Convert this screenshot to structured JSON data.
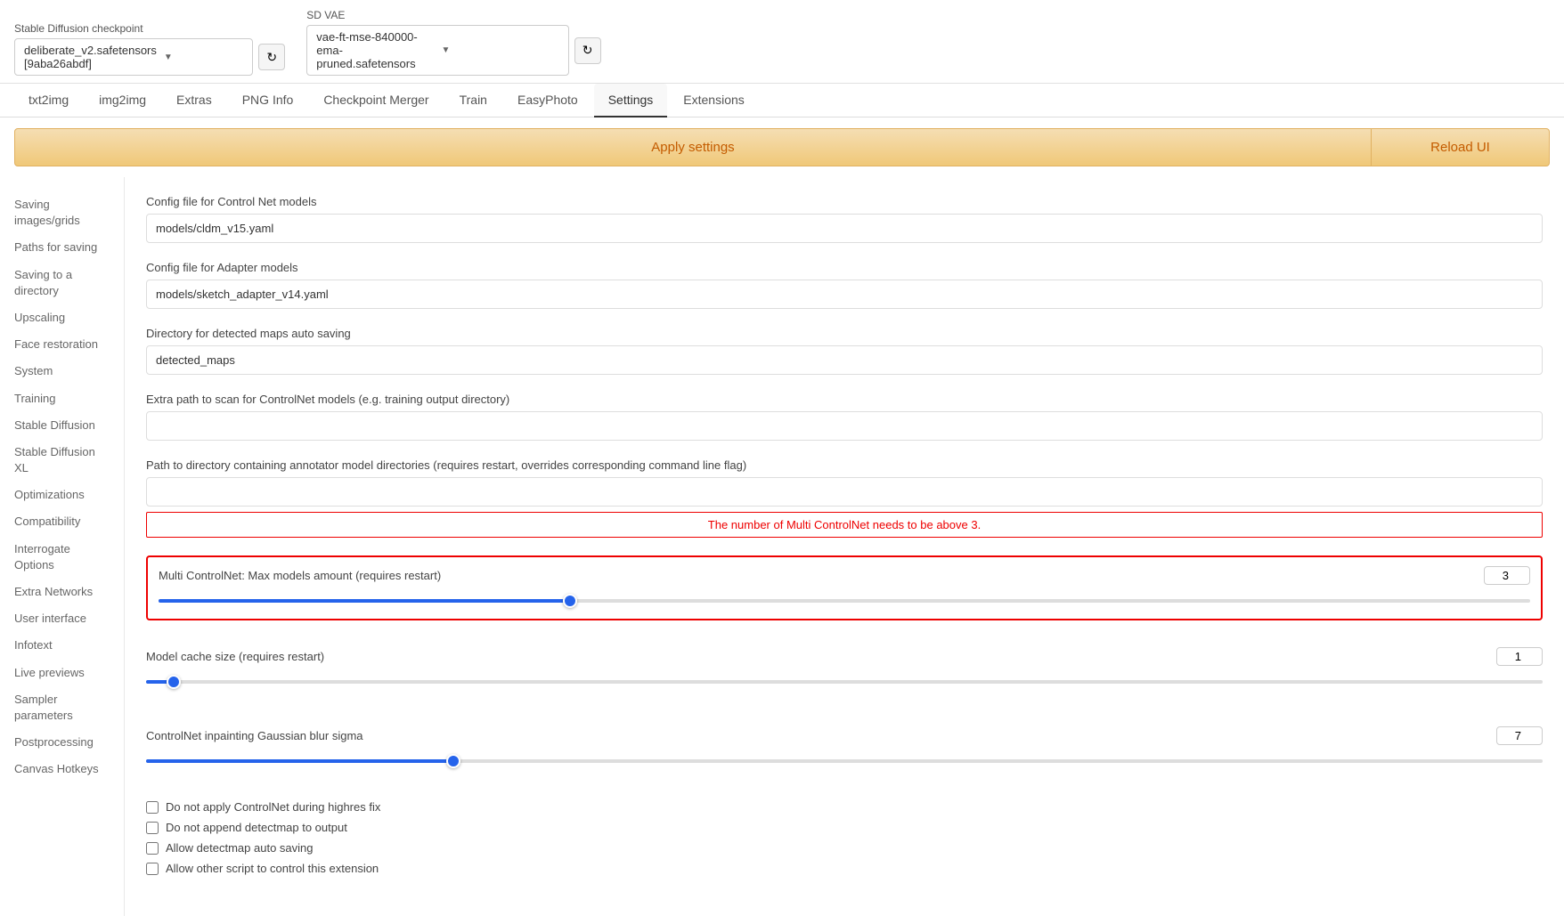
{
  "topbar": {
    "checkpoint_label": "Stable Diffusion checkpoint",
    "checkpoint_value": "deliberate_v2.safetensors [9aba26abdf]",
    "vae_label": "SD VAE",
    "vae_value": "vae-ft-mse-840000-ema-pruned.safetensors"
  },
  "nav": {
    "tabs": [
      {
        "id": "txt2img",
        "label": "txt2img"
      },
      {
        "id": "img2img",
        "label": "img2img"
      },
      {
        "id": "extras",
        "label": "Extras"
      },
      {
        "id": "png-info",
        "label": "PNG Info"
      },
      {
        "id": "checkpoint-merger",
        "label": "Checkpoint Merger"
      },
      {
        "id": "train",
        "label": "Train"
      },
      {
        "id": "easyphoto",
        "label": "EasyPhoto"
      },
      {
        "id": "settings",
        "label": "Settings",
        "active": true
      },
      {
        "id": "extensions",
        "label": "Extensions"
      }
    ]
  },
  "actions": {
    "apply_label": "Apply settings",
    "reload_label": "Reload UI"
  },
  "sidebar": {
    "items": [
      {
        "id": "saving-images",
        "label": "Saving images/grids"
      },
      {
        "id": "paths-saving",
        "label": "Paths for saving"
      },
      {
        "id": "saving-directory",
        "label": "Saving to a directory"
      },
      {
        "id": "upscaling",
        "label": "Upscaling"
      },
      {
        "id": "face-restoration",
        "label": "Face restoration"
      },
      {
        "id": "system",
        "label": "System"
      },
      {
        "id": "training",
        "label": "Training"
      },
      {
        "id": "stable-diffusion",
        "label": "Stable Diffusion"
      },
      {
        "id": "stable-diffusion-xl",
        "label": "Stable Diffusion XL"
      },
      {
        "id": "optimizations",
        "label": "Optimizations"
      },
      {
        "id": "compatibility",
        "label": "Compatibility"
      },
      {
        "id": "interrogate-options",
        "label": "Interrogate Options"
      },
      {
        "id": "extra-networks",
        "label": "Extra Networks"
      },
      {
        "id": "user-interface",
        "label": "User interface"
      },
      {
        "id": "infotext",
        "label": "Infotext"
      },
      {
        "id": "live-previews",
        "label": "Live previews"
      },
      {
        "id": "sampler-parameters",
        "label": "Sampler parameters"
      },
      {
        "id": "postprocessing",
        "label": "Postprocessing"
      },
      {
        "id": "canvas-hotkeys",
        "label": "Canvas Hotkeys"
      }
    ]
  },
  "settings": {
    "controlnet_config_label": "Config file for Control Net models",
    "controlnet_config_value": "models/cldm_v15.yaml",
    "adapter_config_label": "Config file for Adapter models",
    "adapter_config_value": "models/sketch_adapter_v14.yaml",
    "detected_maps_label": "Directory for detected maps auto saving",
    "detected_maps_value": "detected_maps",
    "extra_path_label": "Extra path to scan for ControlNet models (e.g. training output directory)",
    "extra_path_value": "",
    "annotator_path_label": "Path to directory containing annotator model directories (requires restart, overrides corresponding command line flag)",
    "annotator_path_value": "",
    "error_message": "The number of Multi ControlNet needs to be above 3.",
    "multi_controlnet_label": "Multi ControlNet: Max models amount (requires restart)",
    "multi_controlnet_value": "3",
    "multi_controlnet_slider_pct": 30,
    "model_cache_label": "Model cache size (requires restart)",
    "model_cache_value": "1",
    "model_cache_slider_pct": 2,
    "gaussian_blur_label": "ControlNet inpainting Gaussian blur sigma",
    "gaussian_blur_value": "7",
    "gaussian_blur_slider_pct": 22,
    "checkboxes": [
      {
        "id": "no-highres-fix",
        "label": "Do not apply ControlNet during highres fix",
        "checked": false
      },
      {
        "id": "no-append-detectmap",
        "label": "Do not append detectmap to output",
        "checked": false
      },
      {
        "id": "allow-detectmap-saving",
        "label": "Allow detectmap auto saving",
        "checked": false
      },
      {
        "id": "allow-script-control",
        "label": "Allow other script to control this extension",
        "checked": false
      }
    ]
  }
}
